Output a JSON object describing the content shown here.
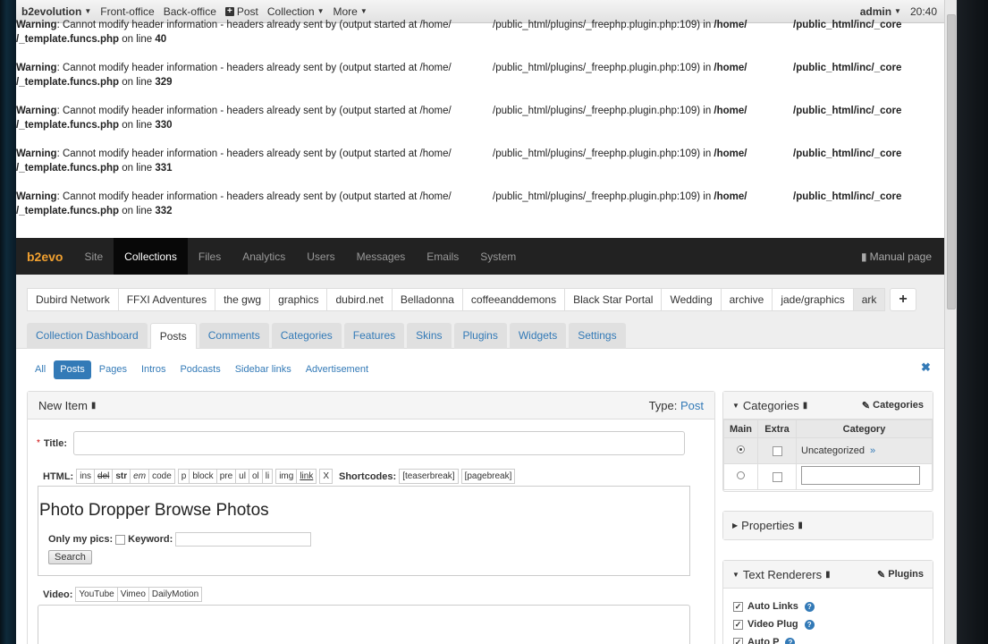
{
  "topbar": {
    "brand": "b2evolution",
    "items": [
      "Front-office",
      "Back-office",
      "Post",
      "Collection",
      "More"
    ],
    "user": "admin",
    "time": "20:40"
  },
  "warnings": [
    {
      "label": "Warning",
      "msg": ": Cannot modify header information - headers already sent by (output started at /home/",
      "mid": "/public_html/plugins/_freephp.plugin.php:109) in ",
      "home": "/home/",
      "path": "/public_html/inc/_core",
      "file": "/_template.funcs.php",
      "online": " on line ",
      "line": "40"
    },
    {
      "label": "Warning",
      "msg": ": Cannot modify header information - headers already sent by (output started at /home/",
      "mid": "/public_html/plugins/_freephp.plugin.php:109) in ",
      "home": "/home/",
      "path": "/public_html/inc/_core",
      "file": "/_template.funcs.php",
      "online": " on line ",
      "line": "329"
    },
    {
      "label": "Warning",
      "msg": ": Cannot modify header information - headers already sent by (output started at /home/",
      "mid": "/public_html/plugins/_freephp.plugin.php:109) in ",
      "home": "/home/",
      "path": "/public_html/inc/_core",
      "file": "/_template.funcs.php",
      "online": " on line ",
      "line": "330"
    },
    {
      "label": "Warning",
      "msg": ": Cannot modify header information - headers already sent by (output started at /home/",
      "mid": "/public_html/plugins/_freephp.plugin.php:109) in ",
      "home": "/home/",
      "path": "/public_html/inc/_core",
      "file": "/_template.funcs.php",
      "online": " on line ",
      "line": "331"
    },
    {
      "label": "Warning",
      "msg": ": Cannot modify header information - headers already sent by (output started at /home/",
      "mid": "/public_html/plugins/_freephp.plugin.php:109) in ",
      "home": "/home/",
      "path": "/public_html/inc/_core",
      "file": "/_template.funcs.php",
      "online": " on line ",
      "line": "332"
    }
  ],
  "mainnav": {
    "logo": "b2evo",
    "items": [
      "Site",
      "Collections",
      "Files",
      "Analytics",
      "Users",
      "Messages",
      "Emails",
      "System"
    ],
    "manual": "Manual page"
  },
  "collections": [
    "Dubird Network",
    "FFXI Adventures",
    "the gwg",
    "graphics",
    "dubird.net",
    "Belladonna",
    "coffeeanddemons",
    "Black Star Portal",
    "Wedding",
    "archive",
    "jade/graphics",
    "ark"
  ],
  "collection_add": "+",
  "subtabs": [
    "Collection Dashboard",
    "Posts",
    "Comments",
    "Categories",
    "Features",
    "Skins",
    "Plugins",
    "Widgets",
    "Settings"
  ],
  "filters": [
    "All",
    "Posts",
    "Pages",
    "Intros",
    "Podcasts",
    "Sidebar links",
    "Advertisement"
  ],
  "close": "✖",
  "item_panel": {
    "title": "New Item",
    "type_label": "Type:",
    "type_value": "Post",
    "title_label": "Title:",
    "required": "*",
    "html_label": "HTML:",
    "html_buttons": [
      "ins",
      "del",
      "str",
      "em",
      "code",
      "p",
      "block",
      "pre",
      "ul",
      "ol",
      "li",
      "img",
      "link",
      "X"
    ],
    "shortcodes_label": "Shortcodes:",
    "shortcode_buttons": [
      "[teaserbreak]",
      "[pagebreak]"
    ],
    "editor_heading": "Photo Dropper Browse Photos",
    "only_my_pics": "Only my pics:",
    "keyword": "Keyword:",
    "search_button": "Search",
    "video_label": "Video:",
    "video_buttons": [
      "YouTube",
      "Vimeo",
      "DailyMotion"
    ]
  },
  "categories_panel": {
    "title": "Categories",
    "link": "Categories",
    "headers": [
      "Main",
      "Extra",
      "Category"
    ],
    "rows": [
      {
        "name": "Uncategorized",
        "arrow": "»"
      }
    ]
  },
  "properties_panel": {
    "title": "Properties"
  },
  "renderers_panel": {
    "title": "Text Renderers",
    "link": "Plugins",
    "items": [
      "Auto Links",
      "Video Plug",
      "Auto P"
    ]
  }
}
